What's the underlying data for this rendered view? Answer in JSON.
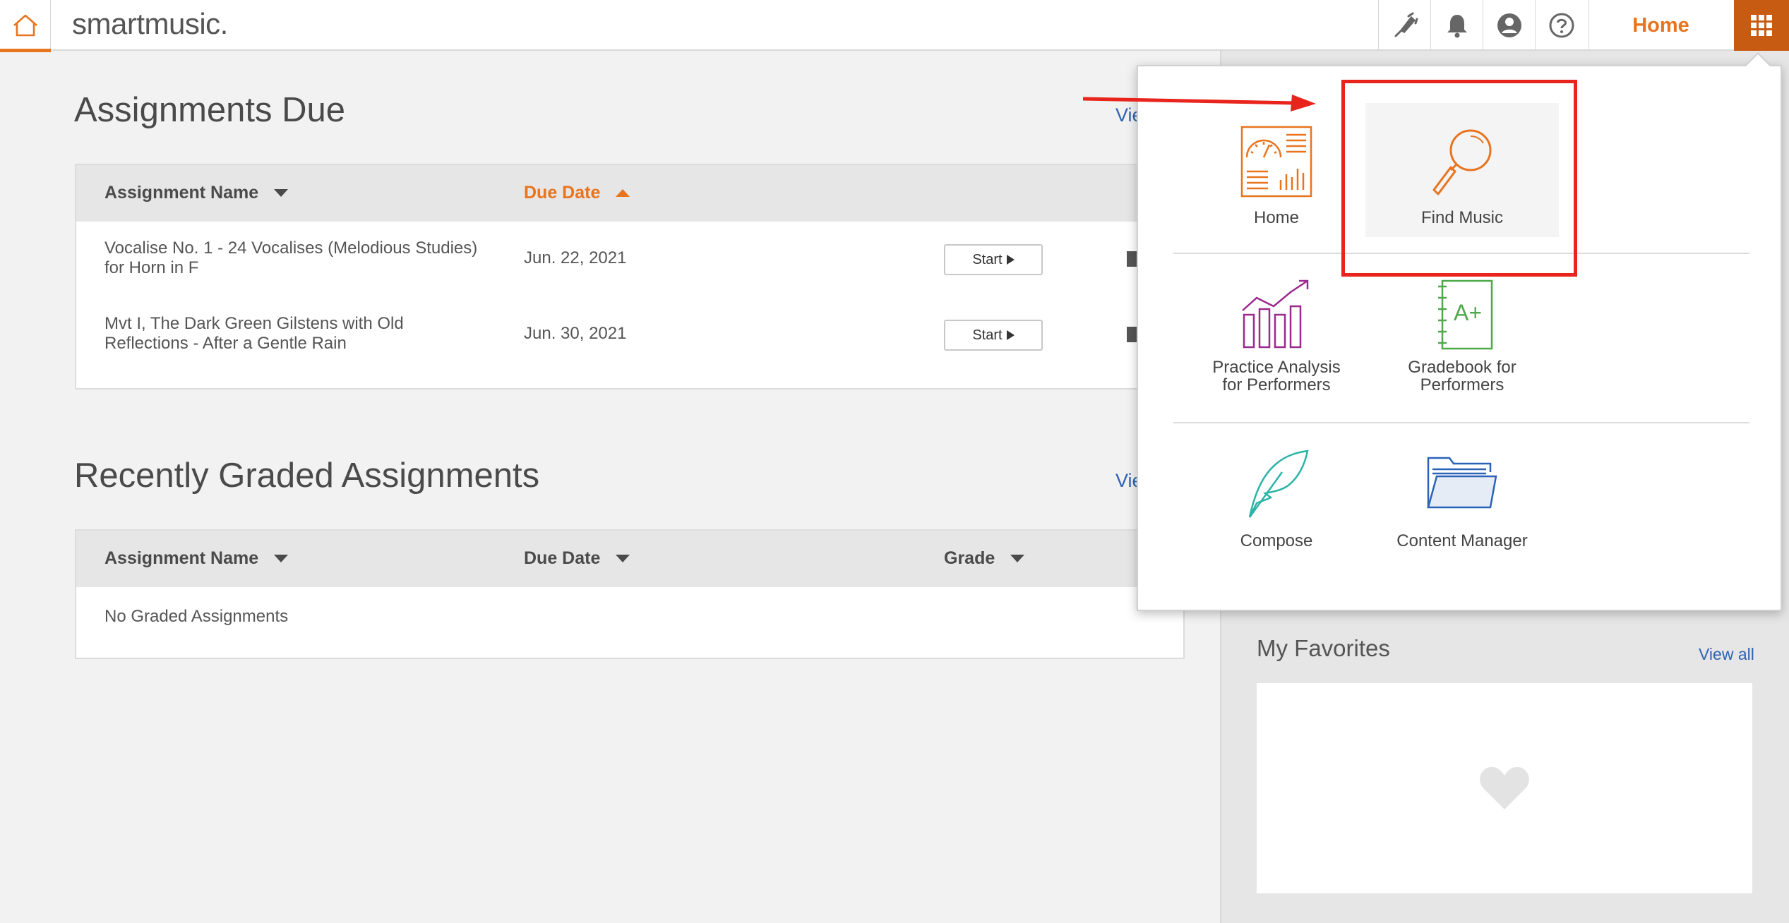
{
  "topbar": {
    "logo": "smartmusic.",
    "home_label": "Home",
    "icons": [
      "home-icon",
      "tuner-fork-icon",
      "bell-icon",
      "user-icon",
      "help-icon",
      "grid-icon"
    ]
  },
  "assignments_due": {
    "title": "Assignments Due",
    "view_link": "Vie",
    "columns": {
      "name": "Assignment Name",
      "due": "Due Date"
    },
    "rows": [
      {
        "name_line1": "Vocalise No. 1 - 24 Vocalises (Melodious Studies)",
        "name_line2": "for Horn in F",
        "due": "Jun. 22, 2021",
        "action": "Start"
      },
      {
        "name_line1": "Mvt I, The Dark Green Gilstens with Old",
        "name_line2": "Reflections - After a Gentle Rain",
        "due": "Jun. 30, 2021",
        "action": "Start"
      }
    ]
  },
  "recently_graded": {
    "title": "Recently Graded Assignments",
    "view_link": "Vie",
    "columns": {
      "name": "Assignment Name",
      "due": "Due Date",
      "grade": "Grade"
    },
    "empty": "No Graded Assignments"
  },
  "favorites": {
    "title": "My Favorites",
    "view_link": "View all"
  },
  "apps_menu": {
    "items": [
      {
        "label_line1": "Home",
        "label_line2": ""
      },
      {
        "label_line1": "Find Music",
        "label_line2": ""
      },
      {
        "label_line1": "Practice Analysis",
        "label_line2": "for Performers"
      },
      {
        "label_line1": "Gradebook for",
        "label_line2": "Performers"
      },
      {
        "label_line1": "Compose",
        "label_line2": ""
      },
      {
        "label_line1": "Content Manager",
        "label_line2": ""
      }
    ]
  },
  "colors": {
    "accent": "#e8741e",
    "accent_dark": "#c85b12",
    "link": "#2f62b5",
    "annotation": "#e8241c",
    "practice_icon": "#9b2a8e",
    "gradebook_icon": "#4fa84a",
    "compose_icon": "#2bb3a8",
    "content_icon": "#2a62b8"
  }
}
